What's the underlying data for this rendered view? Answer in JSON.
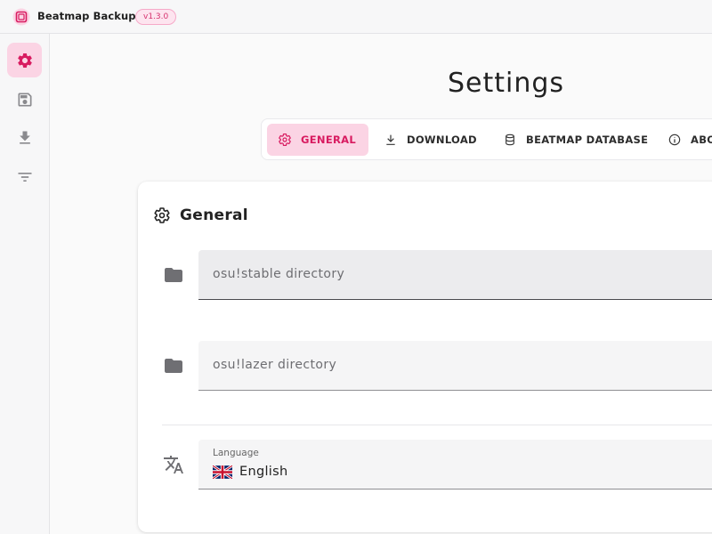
{
  "app": {
    "name": "Beatmap Backup",
    "version": "v1.3.0",
    "accent_color": "#d81b60",
    "accent_light": "#fbd4e4"
  },
  "sidebar": {
    "items": [
      {
        "icon": "gear-icon",
        "active": true
      },
      {
        "icon": "save-icon",
        "active": false
      },
      {
        "icon": "download-icon",
        "active": false
      },
      {
        "icon": "filter-icon",
        "active": false
      }
    ]
  },
  "page": {
    "title": "Settings"
  },
  "tabs": [
    {
      "label": "GENERAL",
      "icon": "gear-icon",
      "active": true
    },
    {
      "label": "DOWNLOAD",
      "icon": "download-icon",
      "active": false
    },
    {
      "label": "BEATMAP DATABASE",
      "icon": "database-icon",
      "active": false
    },
    {
      "label": "ABOUT",
      "icon": "info-icon",
      "active": false
    }
  ],
  "general": {
    "title": "General",
    "stable_directory": {
      "placeholder": "osu!stable directory",
      "value": ""
    },
    "lazer_directory": {
      "placeholder": "osu!lazer directory",
      "value": ""
    },
    "language": {
      "label": "Language",
      "value": "English",
      "flag": "uk-flag-icon"
    }
  }
}
